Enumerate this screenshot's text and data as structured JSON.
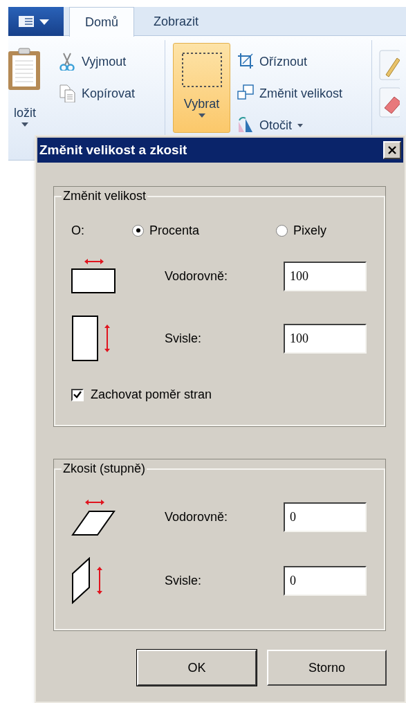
{
  "tabs": [
    {
      "label": "Domů",
      "selected": true
    },
    {
      "label": "Zobrazit",
      "selected": false
    }
  ],
  "ribbon": {
    "paste": {
      "label": "ložit"
    },
    "clipboard_items": [
      {
        "kind": "cut",
        "label": "Vyjmout"
      },
      {
        "kind": "copy",
        "label": "Kopírovat"
      }
    ],
    "select": {
      "label": "Vybrat",
      "selected": true
    },
    "image_items": [
      {
        "kind": "crop",
        "label": "Oříznout",
        "dropdown": false
      },
      {
        "kind": "resize",
        "label": "Změnit velikost",
        "dropdown": false
      },
      {
        "kind": "rotate",
        "label": "Otočit",
        "dropdown": true
      }
    ]
  },
  "dialog": {
    "title": "Změnit velikost a zkosit",
    "resize": {
      "legend": "Změnit velikost",
      "by_label": "O:",
      "units": [
        {
          "label": "Procenta",
          "selected": true
        },
        {
          "label": "Pixely",
          "selected": false
        }
      ],
      "fields": [
        {
          "kind": "horizontal",
          "label": "Vodorovně:",
          "value": "100"
        },
        {
          "kind": "vertical",
          "label": "Svisle:",
          "value": "100"
        }
      ],
      "keep_ratio": {
        "label": "Zachovat poměr stran",
        "checked": true
      }
    },
    "skew": {
      "legend": "Zkosit (stupně)",
      "fields": [
        {
          "kind": "skew_horizontal",
          "label": "Vodorovně:",
          "value": "0"
        },
        {
          "kind": "skew_vertical",
          "label": "Svisle:",
          "value": "0"
        }
      ]
    },
    "buttons": [
      {
        "label": "OK",
        "default": true
      },
      {
        "label": "Storno",
        "default": false
      }
    ]
  }
}
